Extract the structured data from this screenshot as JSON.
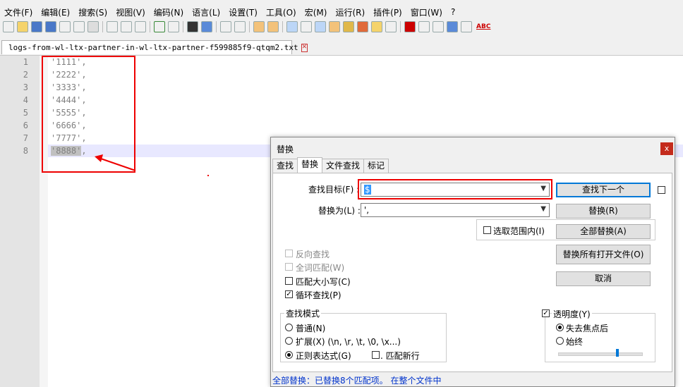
{
  "menu": [
    "文件(F)",
    "编辑(E)",
    "搜索(S)",
    "视图(V)",
    "编码(N)",
    "语言(L)",
    "设置(T)",
    "工具(O)",
    "宏(M)",
    "运行(R)",
    "插件(P)",
    "窗口(W)",
    "?"
  ],
  "toolbar": {
    "spell_label": "ABC"
  },
  "tab": {
    "filename": "logs-from-wl-ltx-partner-in-wl-ltx-partner-f599885f9-qtqm2.txt",
    "close": "✕"
  },
  "editor": {
    "line_numbers": [
      "1",
      "2",
      "3",
      "4",
      "5",
      "6",
      "7",
      "8"
    ],
    "lines": [
      "'1111',",
      "'2222',",
      "'3333',",
      "'4444',",
      "'5555',",
      "'6666',",
      "'7777',"
    ],
    "last_line_selected": "'8888'",
    "last_line_rest": ","
  },
  "dialog": {
    "title": "替换",
    "close": "x",
    "tabs": [
      "查找",
      "替换",
      "文件查找",
      "标记"
    ],
    "find_label": "查找目标(F) :",
    "find_value": "$",
    "replace_label": "替换为(L) :",
    "replace_value": "',",
    "in_selection": "选取范围内(I)",
    "buttons": {
      "find_next": "查找下一个",
      "replace": "替换(R)",
      "replace_all": "全部替换(A)",
      "replace_all_open": "替换所有打开文件(O)",
      "cancel": "取消"
    },
    "options": {
      "backward": "反向查找",
      "whole_word": "全词匹配(W)",
      "match_case": "匹配大小写(C)",
      "wrap": "循环查找(P)"
    },
    "mode": {
      "title": "查找模式",
      "normal": "普通(N)",
      "extended": "扩展(X) (\\n, \\r, \\t, \\0, \\x...)",
      "regex": "正则表达式(G)",
      "dot_newline": ". 匹配新行"
    },
    "transparency": {
      "title": "透明度(Y)",
      "on_lose_focus": "失去焦点后",
      "always": "始终",
      "level": 0.72
    },
    "status": "全部替换：已替换8个匹配项。 在整个文件中"
  }
}
